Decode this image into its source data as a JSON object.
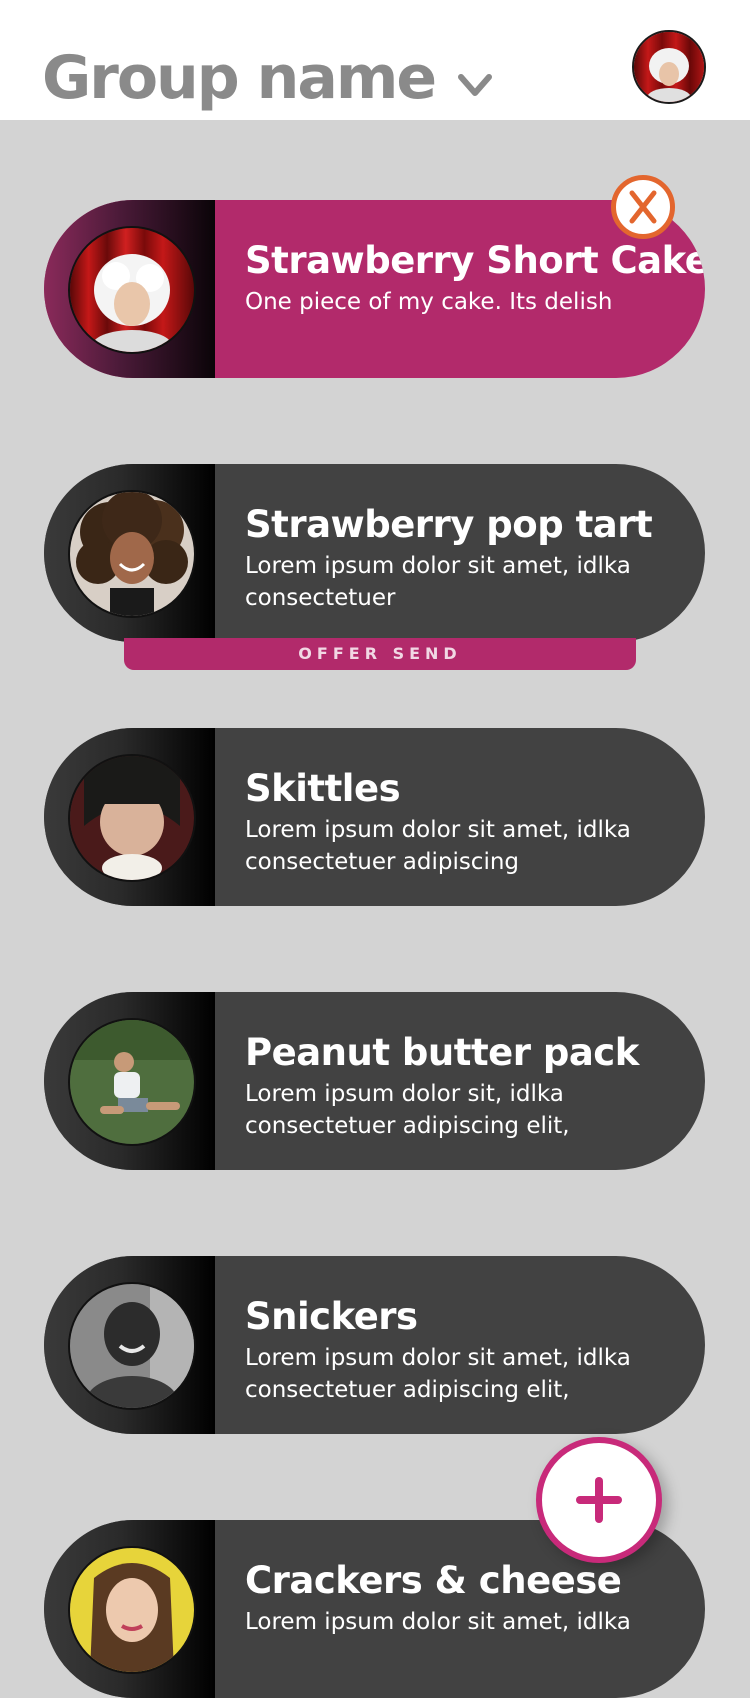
{
  "header": {
    "group_name": "Group name",
    "dropdown_icon": "chevron-down-icon",
    "avatar_icon": "user-avatar"
  },
  "colors": {
    "accent": "#b22a6b",
    "card_bg": "#424242",
    "close_accent": "#e3662e",
    "background": "#d3d3d3",
    "title_grey": "#8a8a8a"
  },
  "cards": [
    {
      "name": "Strawberry Short Cake",
      "desc": "One piece of my cake. Its delish",
      "active": true
    },
    {
      "name": "Strawberry pop tart",
      "desc": "Lorem ipsum dolor sit amet, idlka consectetuer",
      "banner": "OFFER SEND"
    },
    {
      "name": "Skittles",
      "desc": "Lorem ipsum dolor sit amet, idlka consectetuer adipiscing"
    },
    {
      "name": "Peanut butter pack",
      "desc": "Lorem ipsum dolor sit, idlka consectetuer adipiscing elit,"
    },
    {
      "name": "Snickers",
      "desc": "Lorem ipsum dolor sit amet, idlka consectetuer adipiscing elit,"
    },
    {
      "name": "Crackers & cheese",
      "desc": "Lorem ipsum dolor sit amet, idlka"
    }
  ],
  "actions": {
    "close_icon": "close-icon",
    "add_icon": "plus-icon"
  }
}
